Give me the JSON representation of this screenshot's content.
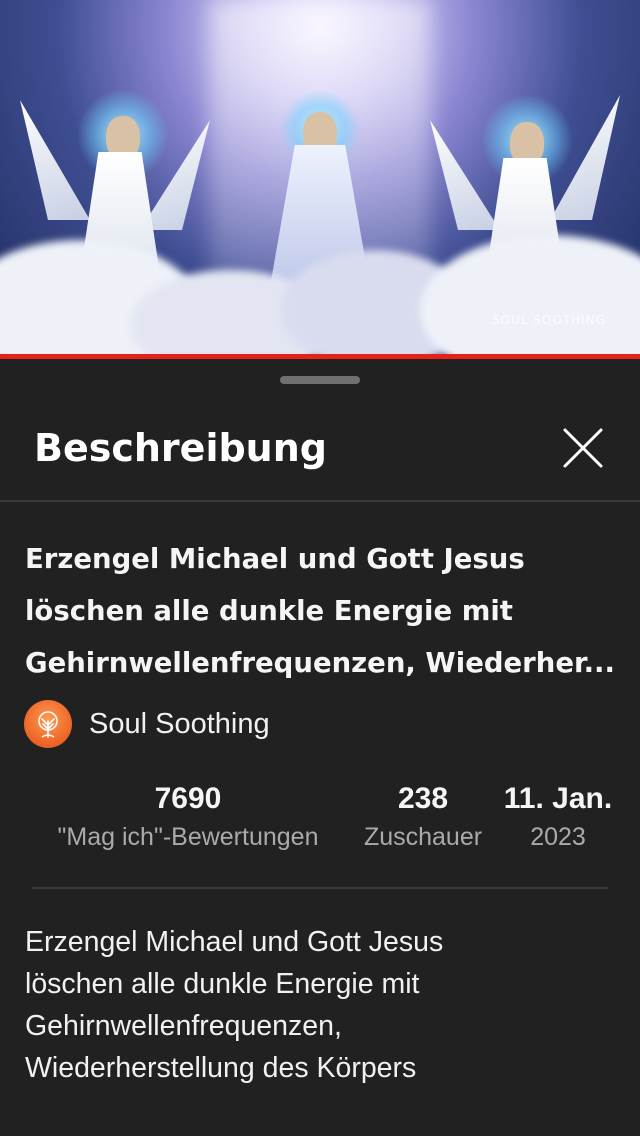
{
  "video": {
    "watermark": "SOUL SOOTHING",
    "progress_fraction": 1.0,
    "progress_color": "#e62117"
  },
  "sheet": {
    "title": "Beschreibung",
    "close_icon": "close-icon"
  },
  "video_info": {
    "title_lines": [
      "Erzengel Michael und Gott Jesus",
      "löschen alle dunkle Energie mit",
      "Gehirnwellenfrequenzen, Wiederher..."
    ],
    "channel": {
      "name": "Soul Soothing",
      "avatar_icon": "tree-of-life-icon"
    },
    "stats": [
      {
        "value": "7690",
        "label": "\"Mag ich\"-Bewertungen"
      },
      {
        "value": "238",
        "label": "Zuschauer"
      },
      {
        "value": "11. Jan.",
        "label": "2023"
      }
    ],
    "description_lines": [
      "Erzengel Michael und Gott Jesus",
      "löschen alle dunkle Energie mit",
      "Gehirnwellenfrequenzen,",
      "Wiederherstellung des Körpers"
    ]
  }
}
